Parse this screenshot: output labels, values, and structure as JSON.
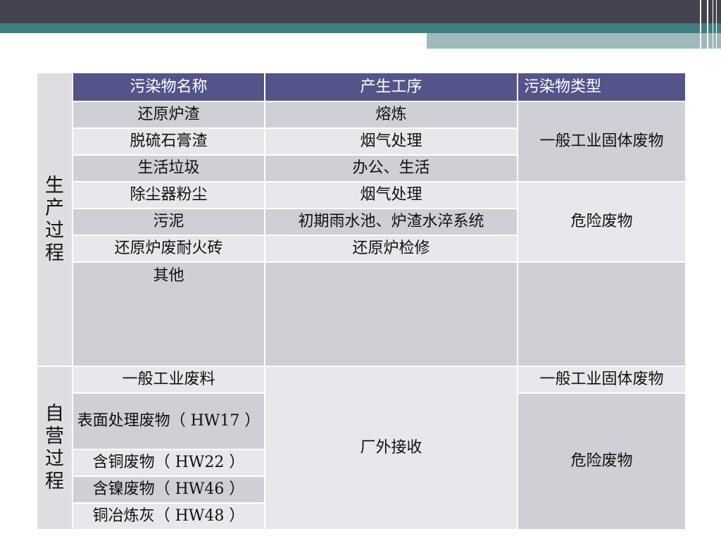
{
  "sections": {
    "production": "生产过程",
    "self_operated": "自营过程"
  },
  "headers": [
    "污染物名称",
    "产生工序",
    "污染物类型"
  ],
  "production_rows": [
    {
      "name": "还原炉渣",
      "process": "熔炼"
    },
    {
      "name": "脱硫石膏渣",
      "process": "烟气处理"
    },
    {
      "name": "生活垃圾",
      "process": "办公、生活"
    },
    {
      "name": "除尘器粉尘",
      "process": "烟气处理"
    },
    {
      "name": "污泥",
      "process": "初期雨水池、炉渣水淬系统"
    },
    {
      "name": "还原炉废耐火砖",
      "process": "还原炉检修"
    },
    {
      "name": "其他",
      "process": ""
    }
  ],
  "production_types": {
    "general": "一般工业固体废物",
    "hazardous": "危险废物"
  },
  "self_rows": [
    {
      "name": "一般工业废料"
    },
    {
      "name": "表面处理废物（ HW17 ）"
    },
    {
      "name": "含铜废物（ HW22 ）"
    },
    {
      "name": "含镍废物（ HW46 ）"
    },
    {
      "name": "铜冶炼灰（ HW48 ）"
    }
  ],
  "self_process": "厂外接收",
  "self_types": {
    "general": "一般工业固体废物",
    "hazardous": "危险废物"
  }
}
